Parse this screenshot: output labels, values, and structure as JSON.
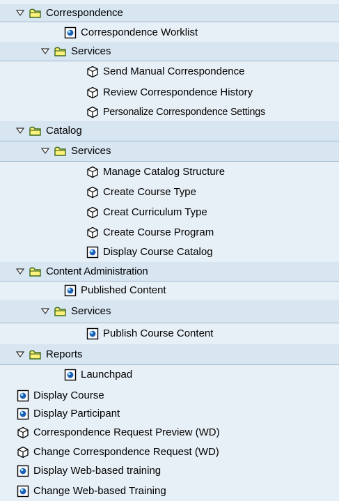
{
  "tree": {
    "rows": [
      {
        "label": "Correspondence",
        "icon": "folder-icon",
        "expanded": true
      },
      {
        "label": "Correspondence Worklist",
        "icon": "document-icon"
      },
      {
        "label": "Services",
        "icon": "folder-icon",
        "expanded": true
      },
      {
        "label": "Send Manual Correspondence",
        "icon": "service-cube-icon"
      },
      {
        "label": "Review Correspondence History",
        "icon": "service-cube-icon"
      },
      {
        "label": "Personalize Correspondence Settings",
        "icon": "service-cube-icon"
      },
      {
        "label": "Catalog",
        "icon": "folder-icon",
        "expanded": true
      },
      {
        "label": "Services",
        "icon": "folder-icon",
        "expanded": true
      },
      {
        "label": "Manage Catalog Structure",
        "icon": "service-cube-icon"
      },
      {
        "label": "Create Course Type",
        "icon": "service-cube-icon"
      },
      {
        "label": "Creat Curriculum Type",
        "icon": "service-cube-icon"
      },
      {
        "label": "Create Course Program",
        "icon": "service-cube-icon"
      },
      {
        "label": "Display Course Catalog",
        "icon": "document-icon"
      },
      {
        "label": "Content Administration",
        "icon": "folder-icon",
        "expanded": true
      },
      {
        "label": "Published Content",
        "icon": "document-icon"
      },
      {
        "label": "Services",
        "icon": "folder-icon",
        "expanded": true
      },
      {
        "label": "Publish Course Content",
        "icon": "document-icon"
      },
      {
        "label": "Reports",
        "icon": "folder-icon",
        "expanded": true
      },
      {
        "label": "Launchpad",
        "icon": "document-icon"
      },
      {
        "label": "Display Course",
        "icon": "document-icon"
      },
      {
        "label": "Display Participant",
        "icon": "document-icon"
      },
      {
        "label": "Correspondence Request Preview (WD)",
        "icon": "service-cube-icon"
      },
      {
        "label": "Change Correspondence Request (WD)",
        "icon": "service-cube-icon"
      },
      {
        "label": "Display Web-based training",
        "icon": "document-icon"
      },
      {
        "label": "Change Web-based Training",
        "icon": "document-icon"
      }
    ]
  },
  "colors": {
    "background": "#e8f0f7",
    "group_row_background": "#d8e6f2",
    "folder_fill": "#fff27a",
    "folder_outline": "#3c6a1e",
    "document_blue": "#1a5fb4"
  }
}
